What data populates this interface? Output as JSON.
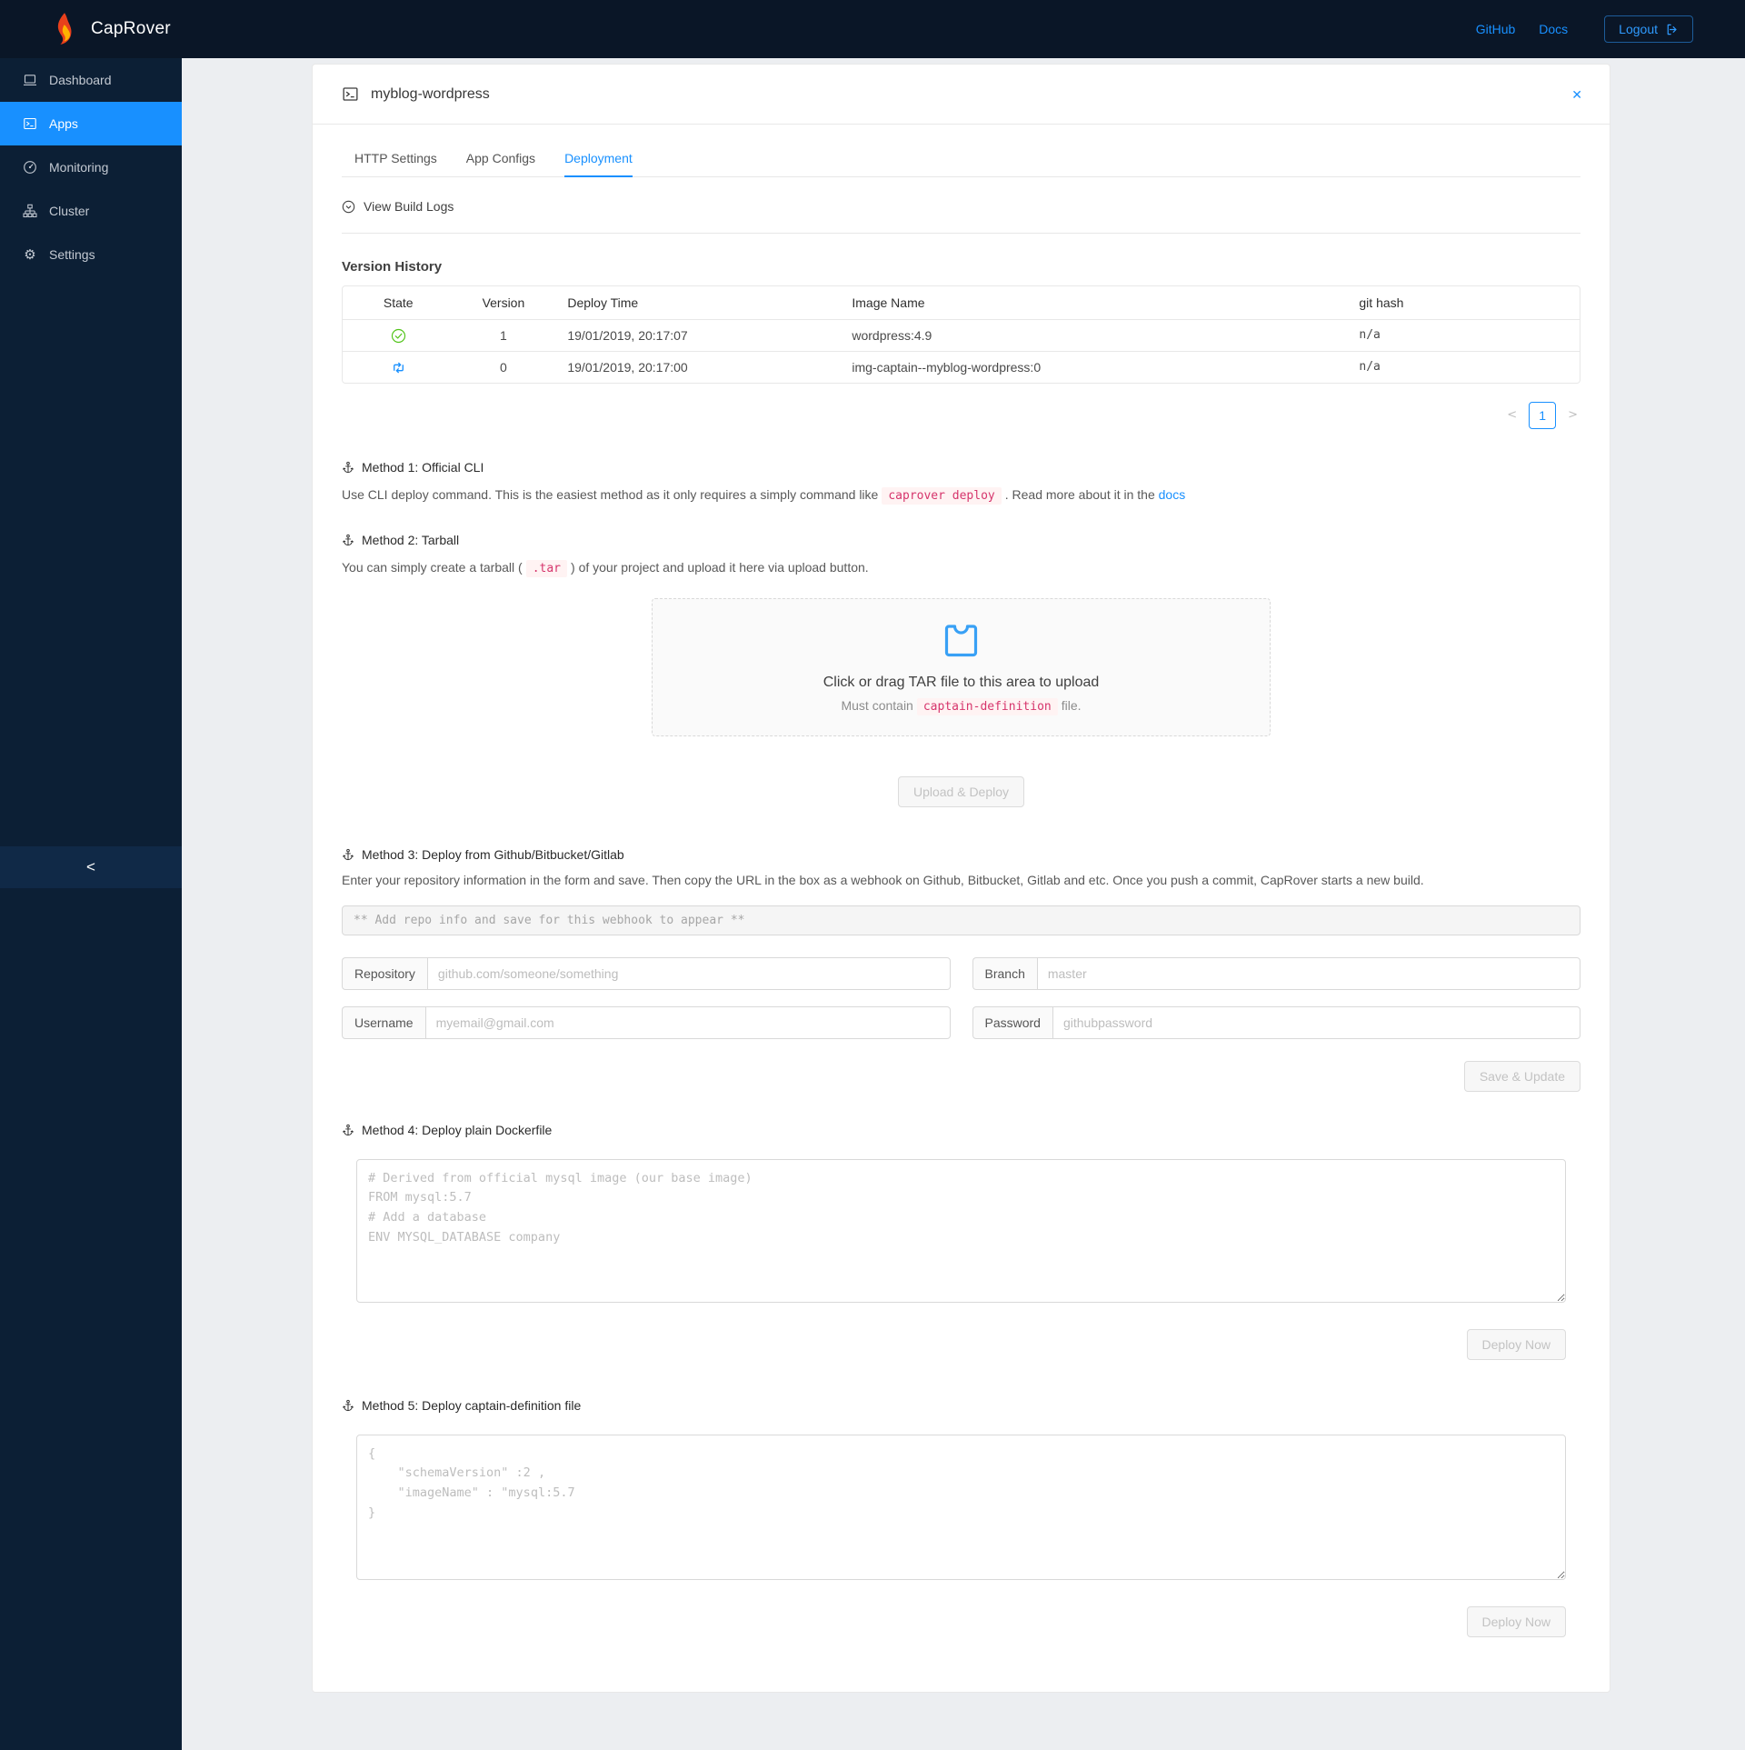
{
  "navbar": {
    "brand": "CapRover",
    "github_label": "GitHub",
    "docs_label": "Docs",
    "logout_label": "Logout"
  },
  "sidebar": {
    "items": [
      {
        "label": "Dashboard",
        "icon": "laptop-icon"
      },
      {
        "label": "Apps",
        "icon": "code-icon"
      },
      {
        "label": "Monitoring",
        "icon": "gauge-icon"
      },
      {
        "label": "Cluster",
        "icon": "cluster-icon"
      },
      {
        "label": "Settings",
        "icon": "gear-icon"
      }
    ],
    "gear_glyph": "⚙",
    "collapse_glyph": "<"
  },
  "app": {
    "title": "myblog-wordpress",
    "close_glyph": "✕"
  },
  "tabs": [
    {
      "label": "HTTP Settings"
    },
    {
      "label": "App Configs"
    },
    {
      "label": "Deployment"
    }
  ],
  "build_logs_label": "View Build Logs",
  "version_history": {
    "title": "Version History",
    "columns": {
      "state": "State",
      "version": "Version",
      "deploy_time": "Deploy Time",
      "image_name": "Image Name",
      "git_hash": "git hash"
    },
    "rows": [
      {
        "state_icon": "check-circle-icon",
        "version": "1",
        "deploy_time": "19/01/2019, 20:17:07",
        "image_name": "wordpress:4.9",
        "git_hash": "n/a"
      },
      {
        "state_icon": "rollback-icon",
        "version": "0",
        "deploy_time": "19/01/2019, 20:17:00",
        "image_name": "img-captain--myblog-wordpress:0",
        "git_hash": "n/a"
      }
    ],
    "pagination": {
      "prev_glyph": "<",
      "current": "1",
      "next_glyph": ">"
    }
  },
  "method1": {
    "title": "Method 1: Official CLI",
    "desc_before": "Use CLI deploy command. This is the easiest method as it only requires a simply command like",
    "code": "caprover deploy",
    "desc_after": ". Read more about it in the",
    "link_label": "docs"
  },
  "method2": {
    "title": "Method 2: Tarball",
    "desc_before": "You can simply create a tarball (",
    "code": ".tar",
    "desc_after": ") of your project and upload it here via upload button.",
    "dragger_title": "Click or drag TAR file to this area to upload",
    "hint_before": "Must contain",
    "hint_code": "captain-definition",
    "hint_after": "file.",
    "upload_button": "Upload & Deploy"
  },
  "method3": {
    "title": "Method 3: Deploy from Github/Bitbucket/Gitlab",
    "desc": "Enter your repository information in the form and save. Then copy the URL in the box as a webhook on Github, Bitbucket, Gitlab and etc. Once you push a commit, CapRover starts a new build.",
    "webhook_placeholder": "** Add repo info and save for this webhook to appear **",
    "fields": [
      {
        "label": "Repository",
        "placeholder": "github.com/someone/something"
      },
      {
        "label": "Branch",
        "placeholder": "master"
      },
      {
        "label": "Username",
        "placeholder": "myemail@gmail.com"
      },
      {
        "label": "Password",
        "placeholder": "githubpassword"
      }
    ],
    "save_button": "Save & Update"
  },
  "method4": {
    "title": "Method 4: Deploy plain Dockerfile",
    "placeholder": "# Derived from official mysql image (our base image)\nFROM mysql:5.7\n# Add a database\nENV MYSQL_DATABASE company",
    "deploy_button": "Deploy Now"
  },
  "method5": {
    "title": "Method 5: Deploy captain-definition file",
    "placeholder": "{\n    \"schemaVersion\" :2 ,\n    \"imageName\" : \"mysql:5.7\n}",
    "deploy_button": "Deploy Now"
  },
  "colors": {
    "accent_blue": "#1890ff",
    "success_green": "#52c41a",
    "code_pink": "#d6356c",
    "sidebar_bg": "#0c1f35",
    "navbar_bg": "#0a1627"
  }
}
